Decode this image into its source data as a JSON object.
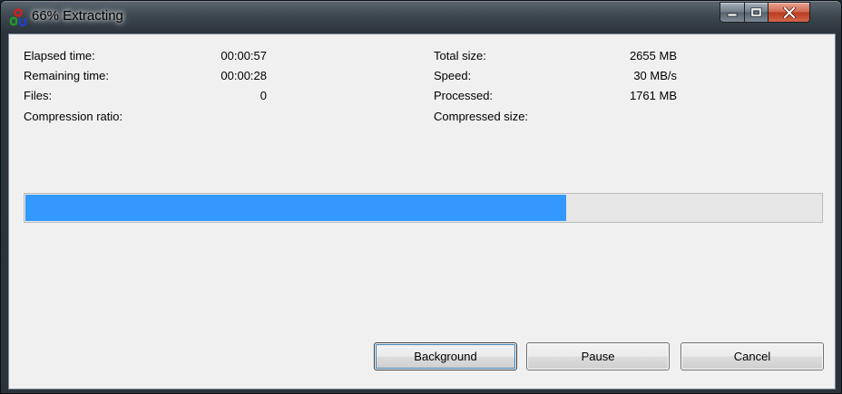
{
  "window": {
    "title": "66% Extracting",
    "app_icon": "7zip-icon"
  },
  "caption": {
    "minimize_icon": "minimize-icon",
    "maximize_icon": "maximize-icon",
    "close_icon": "close-icon"
  },
  "stats": {
    "elapsed_label": "Elapsed time:",
    "elapsed_value": "00:00:57",
    "remaining_label": "Remaining time:",
    "remaining_value": "00:00:28",
    "files_label": "Files:",
    "files_value": "0",
    "ratio_label": "Compression ratio:",
    "ratio_value": "",
    "total_label": "Total size:",
    "total_value": "2655 MB",
    "speed_label": "Speed:",
    "speed_value": "30 MB/s",
    "processed_label": "Processed:",
    "processed_value": "1761 MB",
    "compressed_label": "Compressed size:",
    "compressed_value": ""
  },
  "progress": {
    "fraction": 0.68,
    "fill_color": "#3399ff"
  },
  "buttons": {
    "background_label": "Background",
    "pause_label": "Pause",
    "cancel_label": "Cancel"
  }
}
